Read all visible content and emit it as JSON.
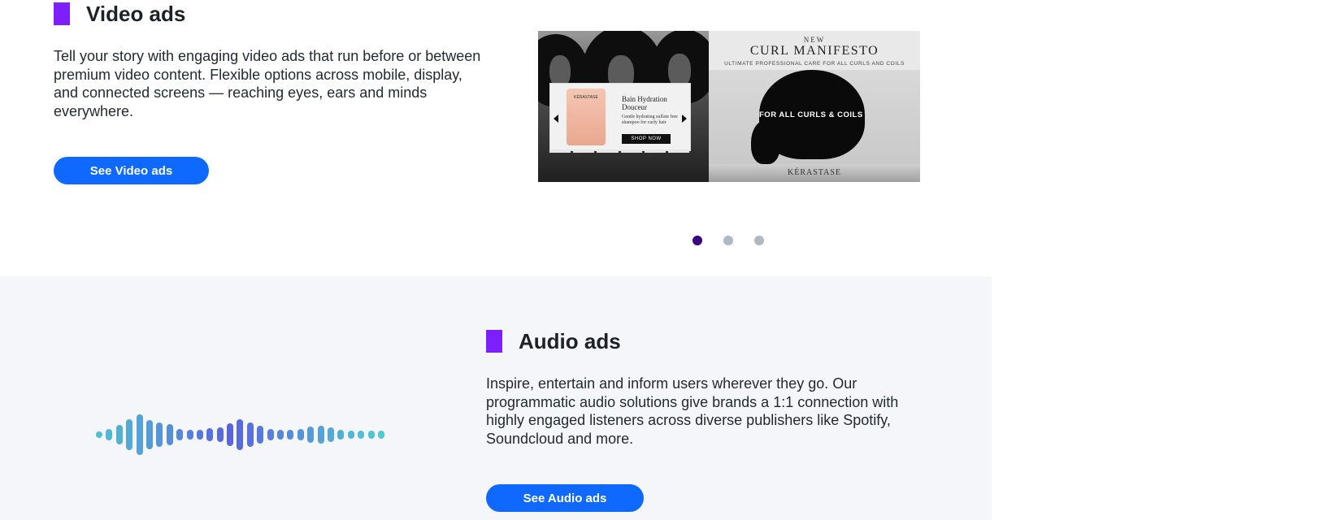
{
  "video": {
    "title": "Video ads",
    "description": "Tell your story with engaging video ads that run before or between premium video content. Flexible options across mobile, display, and connected screens — reaching eyes, ears and minds everywhere.",
    "button_label": "See Video ads",
    "creative": {
      "eyebrow": "NEW",
      "headline": "CURL MANIFESTO",
      "subheadline": "ULTIMATE PROFESSIONAL CARE FOR ALL CURLS AND COILS",
      "tagline": "FOR ALL CURLS & COILS",
      "brand": "KÉRASTASE",
      "product_label": "KÉRASTASE",
      "product_name": "Bain Hydration Douceur",
      "product_desc": "Gentle hydrating sulfate free shampoo for curly hair",
      "shop_label": "SHOP NOW"
    }
  },
  "carousel": {
    "count": 3,
    "active_index": 0
  },
  "audio": {
    "title": "Audio ads",
    "description": "Inspire, entertain and inform users wherever they go. Our programmatic audio solutions give brands a 1:1 connection with highly engaged listeners across diverse publishers like Spotify, Soundcloud and more.",
    "button_label": "See Audio ads"
  },
  "colors": {
    "accent": "#7e1fff",
    "button": "#0f69ff",
    "dot_active": "#39007d",
    "dot_inactive": "#b0b9c1",
    "audio_bg": "#f4f6f9"
  },
  "icons": {
    "carousel_prev": "chevron-left-icon",
    "carousel_next": "chevron-right-icon",
    "waveform": "audio-waveform-icon"
  }
}
